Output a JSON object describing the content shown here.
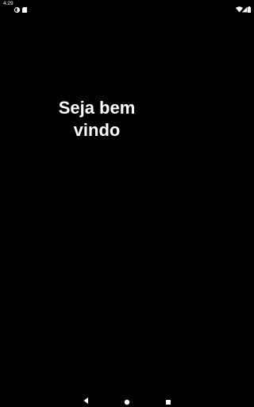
{
  "status_bar": {
    "time": "4:29",
    "icons": {
      "data_saver": "data-saver-icon",
      "sd_card": "sd-card-icon",
      "wifi": "wifi-icon",
      "signal": "cellular-signal-icon",
      "battery": "battery-icon"
    }
  },
  "main": {
    "welcome_text": "Seja bem vindo"
  },
  "nav_bar": {
    "icons": {
      "back": "back-icon",
      "home": "home-icon",
      "recents": "recents-icon"
    }
  },
  "colors": {
    "background": "#000000",
    "foreground": "#ffffff"
  }
}
